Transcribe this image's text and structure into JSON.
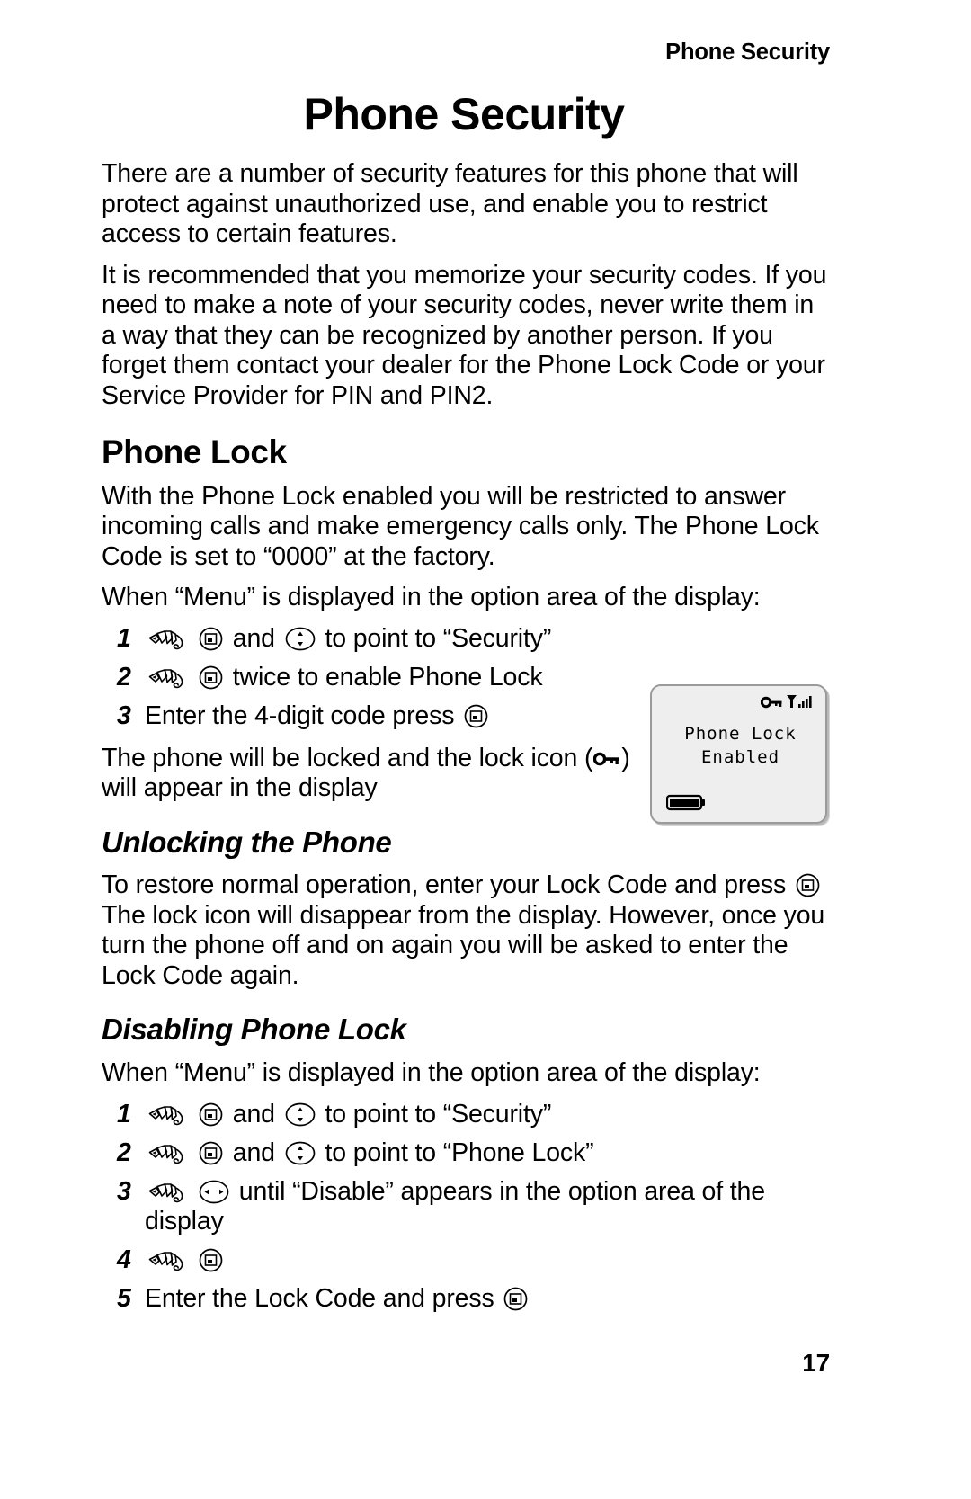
{
  "header": {
    "running_head": "Phone Security"
  },
  "title": "Phone Security",
  "intro": {
    "paragraph_1": "There are a number of security features for this phone that will protect against unauthorized use, and enable you to restrict access to certain features.",
    "paragraph_2": "It is recommended that you memorize your security codes. If you need to make a note of your security codes, never write them in a way that they can be recognized by another person. If you forget them contact your dealer for the Phone Lock Code or your Service Provider for PIN and PIN2."
  },
  "phone_lock": {
    "heading": "Phone Lock",
    "paragraph": "With the Phone Lock enabled you will be restricted to answer incoming calls and make emergency calls only. The Phone Lock Code is set to “0000” at the factory.",
    "steps_lead_in": "When “Menu” is displayed in the option area of the display:",
    "steps": [
      {
        "number": "1",
        "icons": [
          "hand-icon",
          "select-key-icon",
          "nav-updown-key-icon"
        ],
        "text_before_nav": "and",
        "text": "to point to “Security”"
      },
      {
        "number": "2",
        "icons": [
          "hand-icon",
          "select-key-icon"
        ],
        "text": "twice to enable Phone Lock"
      },
      {
        "number": "3",
        "icons": [
          "select-key-icon"
        ],
        "text": "Enter the 4-digit code press"
      }
    ],
    "after_steps_before_lock": "The phone will be locked and the lock icon (",
    "after_steps_after_lock": ") will appear in the display"
  },
  "phone_display": {
    "line_1": "Phone Lock",
    "line_2": "Enabled",
    "status_icons": [
      "lock-icon",
      "signal-strength-icon"
    ],
    "battery_icon": "battery-icon",
    "screen_bg": "#eeeeee",
    "screen_border": "#9a9a9a"
  },
  "unlocking": {
    "heading": "Unlocking the Phone",
    "paragraph_before_key": "To restore normal operation, enter your Lock Code and press",
    "paragraph_after_key": "The lock icon will disappear from the display. However, once you turn the phone off and on again you will be asked to enter the Lock Code again."
  },
  "disabling": {
    "heading": "Disabling Phone Lock",
    "steps_lead_in": "When “Menu” is displayed in the option area of the display:",
    "steps": [
      {
        "number": "1",
        "icons": [
          "hand-icon",
          "select-key-icon",
          "nav-updown-key-icon"
        ],
        "text_before_nav": "and",
        "text": "to point to “Security”"
      },
      {
        "number": "2",
        "icons": [
          "hand-icon",
          "select-key-icon",
          "nav-updown-key-icon"
        ],
        "text_before_nav": "and",
        "text": "to point to “Phone Lock”"
      },
      {
        "number": "3",
        "icons": [
          "hand-icon",
          "nav-leftright-key-icon"
        ],
        "text": "until “Disable” appears in the option area of the display"
      },
      {
        "number": "4",
        "icons": [
          "hand-icon",
          "select-key-icon"
        ],
        "text": ""
      },
      {
        "number": "5",
        "icons": [
          "select-key-icon"
        ],
        "text": "Enter the Lock Code and press"
      }
    ]
  },
  "footer": {
    "page_number": "17"
  }
}
